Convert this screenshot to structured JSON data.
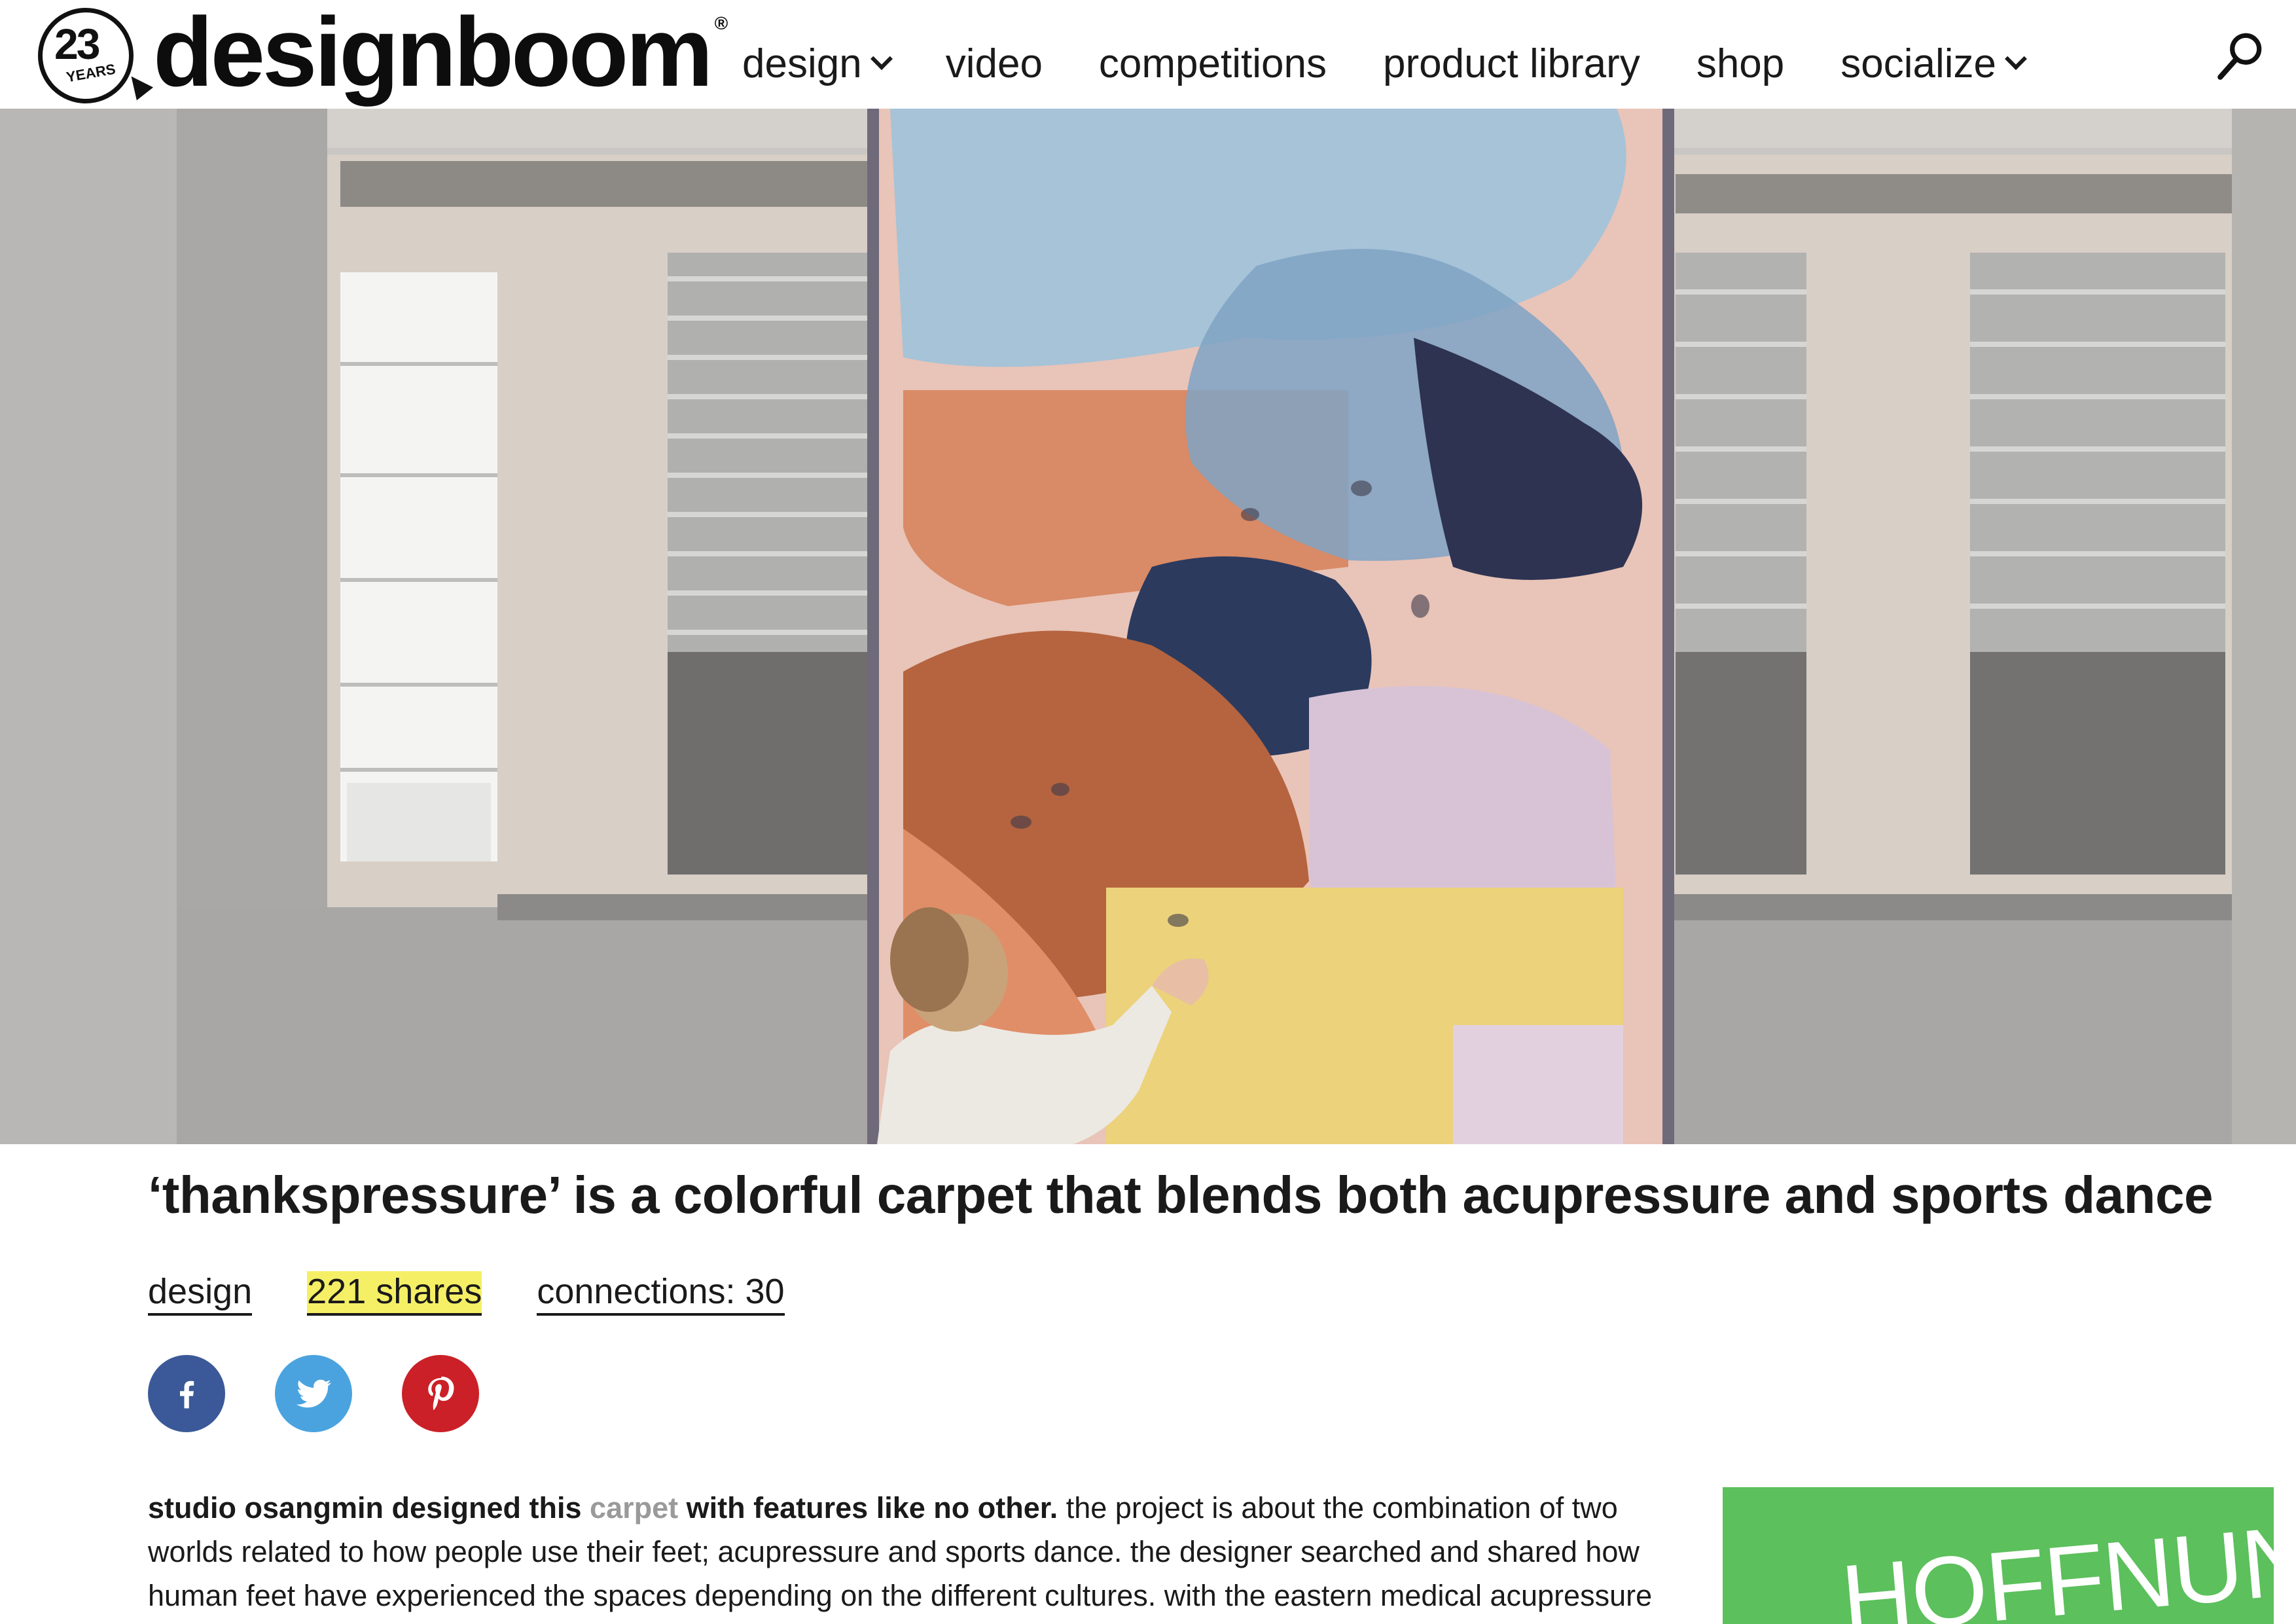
{
  "logo": {
    "badge_number": "23",
    "badge_years": "YEARS",
    "wordmark": "designboom",
    "registered": "®"
  },
  "nav": {
    "items": [
      {
        "label": "design",
        "dropdown": true
      },
      {
        "label": "video",
        "dropdown": false
      },
      {
        "label": "competitions",
        "dropdown": false
      },
      {
        "label": "product library",
        "dropdown": false
      },
      {
        "label": "shop",
        "dropdown": false
      },
      {
        "label": "socialize",
        "dropdown": true
      }
    ],
    "search_icon": "search-icon"
  },
  "hero": {
    "image": "woman pressing hand on colorful woven carpet hanging in industrial room"
  },
  "article": {
    "title": "‘thankspressure’ is a colorful carpet that blends both acupressure and sports dance",
    "category": "design",
    "shares": "221 shares",
    "connections": "connections: 30",
    "social": [
      {
        "name": "facebook",
        "icon": "facebook-icon",
        "color": "#3b5998"
      },
      {
        "name": "twitter",
        "icon": "twitter-icon",
        "color": "#4aa3df"
      },
      {
        "name": "pinterest",
        "icon": "pinterest-icon",
        "color": "#cb2027"
      }
    ],
    "body": {
      "lead_1": "studio osangmin designed this ",
      "lead_link": "carpet",
      "lead_2": " with features like no other.",
      "text": " the project is about the combination of two worlds related to how people use their feet; acupressure and sports dance. the designer searched and shared how human feet have experienced the spaces depending on the different cultures. with the eastern medical acupressure and"
    }
  },
  "ad": {
    "text": "HOFFNUNG?",
    "color": "#5cc05c"
  },
  "highlight_color": "#f5ef66"
}
